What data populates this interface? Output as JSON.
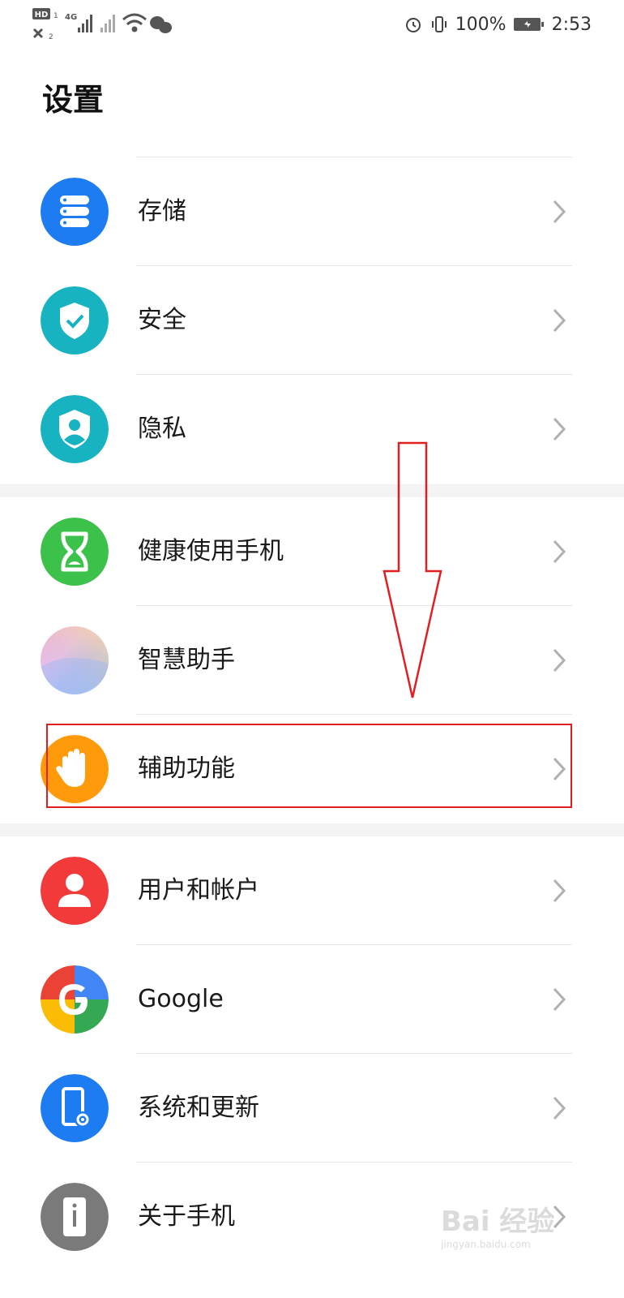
{
  "status_bar": {
    "left_labels": {
      "hd": "HD",
      "network": "4G"
    },
    "battery_percent": "100%",
    "time": "2:53",
    "icons": [
      "hd-icon",
      "signal-icon",
      "wifi-icon",
      "wechat-icon",
      "alarm-icon",
      "vibrate-icon",
      "battery-icon"
    ]
  },
  "page": {
    "title": "设置"
  },
  "items": [
    {
      "label": "存储",
      "icon": "storage-icon",
      "color": "#1e7cf2"
    },
    {
      "label": "安全",
      "icon": "shield-check-icon",
      "color": "#17b3c1"
    },
    {
      "label": "隐私",
      "icon": "privacy-icon",
      "color": "#17b3c1"
    },
    {
      "label": "健康使用手机",
      "icon": "hourglass-icon",
      "color": "#3cc24a"
    },
    {
      "label": "智慧助手",
      "icon": "assistant-icon",
      "color": "#c9a3e8"
    },
    {
      "label": "辅助功能",
      "icon": "hand-icon",
      "color": "#ff9a0a"
    },
    {
      "label": "用户和帐户",
      "icon": "user-icon",
      "color": "#f23a3a"
    },
    {
      "label": "Google",
      "icon": "google-icon",
      "color": "#4285f4"
    },
    {
      "label": "系统和更新",
      "icon": "system-update-icon",
      "color": "#1e7cf2"
    },
    {
      "label": "关于手机",
      "icon": "phone-info-icon",
      "color": "#7a7a7a"
    }
  ],
  "annotation": {
    "color": "#e02020"
  },
  "watermark": {
    "text": "Bai 经验",
    "subtext": "jingyan.baidu.com"
  }
}
